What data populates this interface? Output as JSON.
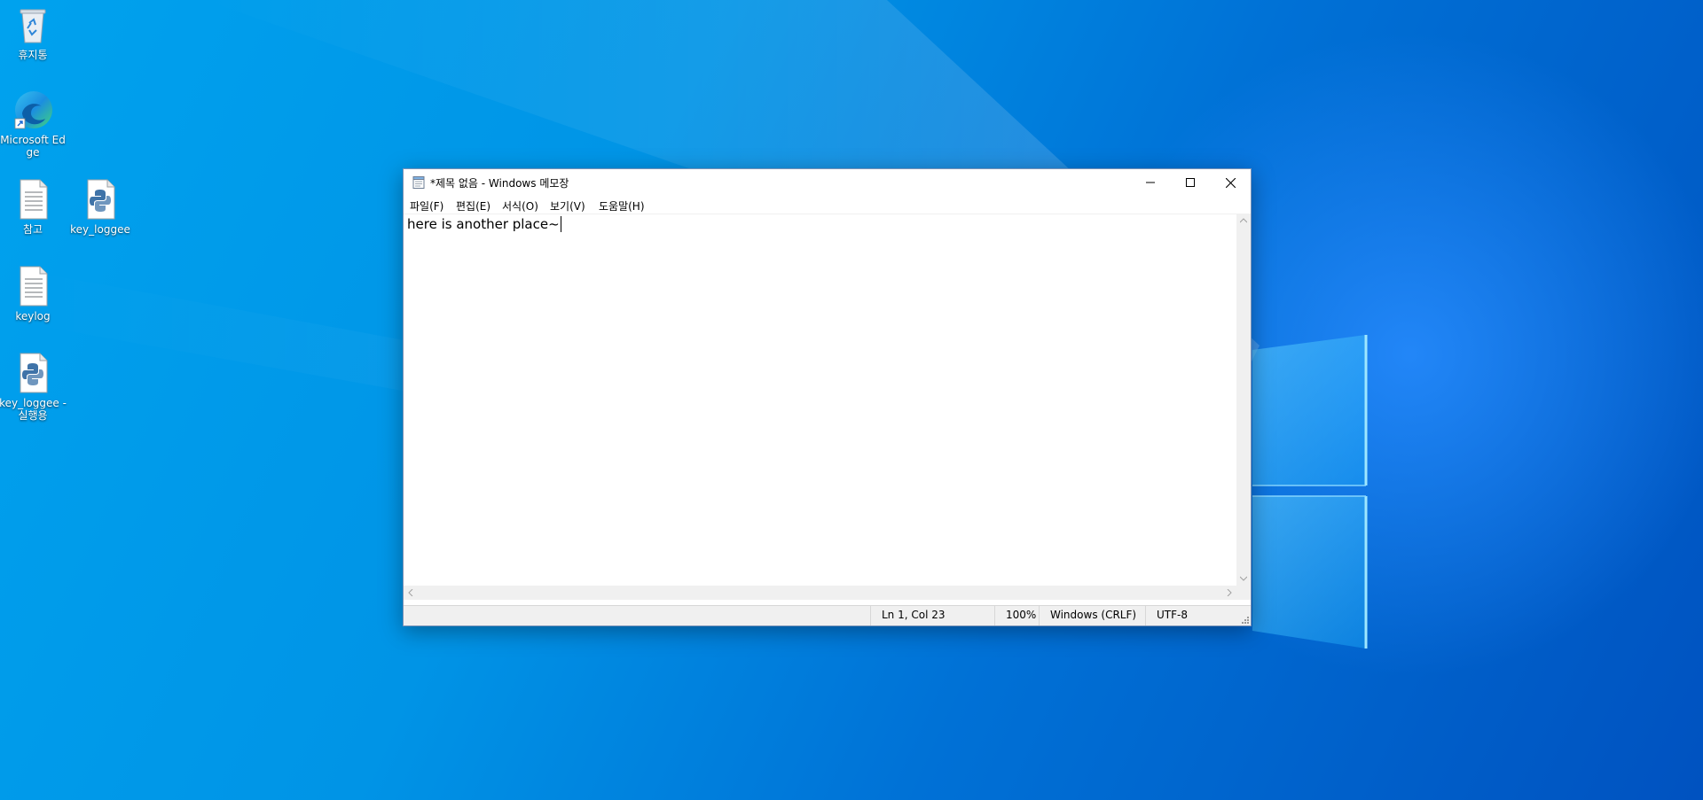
{
  "desktop": {
    "icons": [
      {
        "label": "휴지통",
        "icon": "recycle-bin-icon"
      },
      {
        "label": "Microsoft Edge",
        "icon": "edge-icon"
      },
      {
        "label": "참고",
        "icon": "text-file-icon"
      },
      {
        "label": "key_loggee",
        "icon": "python-file-icon"
      },
      {
        "label": "keylog",
        "icon": "text-file-icon"
      },
      {
        "label": "key_loggee - 실행용",
        "icon": "python-file-icon"
      }
    ]
  },
  "notepad": {
    "title": "*제목 없음 - Windows 메모장",
    "menu": [
      {
        "label": "파일(F)"
      },
      {
        "label": "편집(E)"
      },
      {
        "label": "서식(O)"
      },
      {
        "label": "보기(V)"
      },
      {
        "label": "도움말(H)"
      }
    ],
    "content": "here is another place~",
    "status": {
      "position": "Ln 1, Col 23",
      "zoom": "100%",
      "line_ending": "Windows (CRLF)",
      "encoding": "UTF-8"
    }
  },
  "colors": {
    "wallpaper_light": "#00a2ee",
    "wallpaper_dark": "#0052c0",
    "window_border": "#7a93b8",
    "statusbar_bg": "#f0f0f0"
  }
}
